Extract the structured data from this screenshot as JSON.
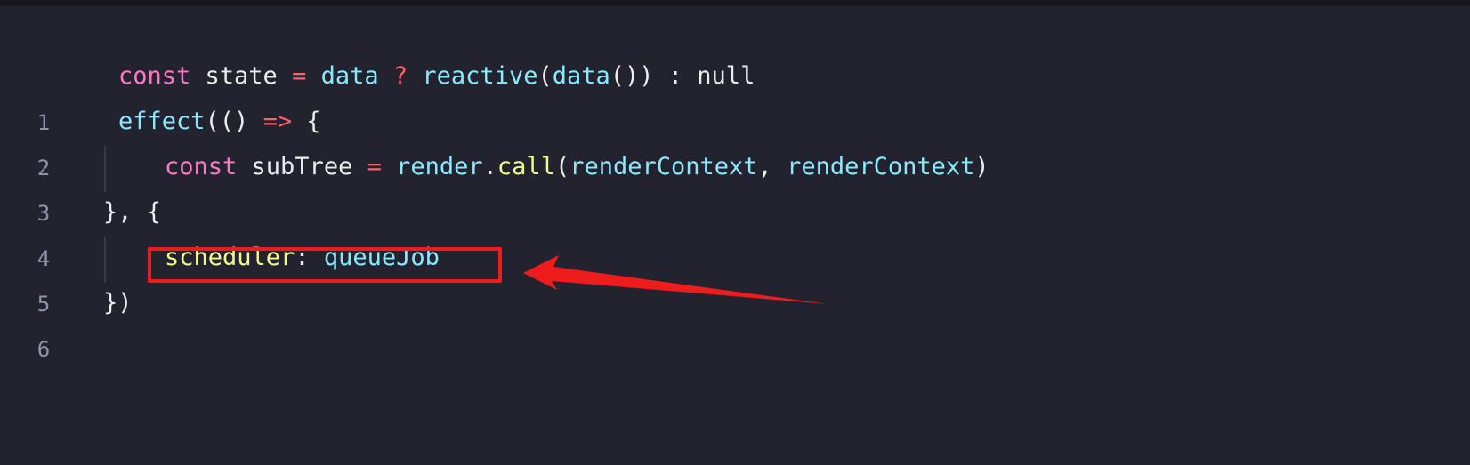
{
  "editor": {
    "lines": [
      {
        "number": "1",
        "tokens": [
          "const",
          " state ",
          "=",
          " data ",
          "?",
          " reactive",
          "(",
          "data",
          "()) : null"
        ]
      },
      {
        "number": "2",
        "tokens": [
          "effect",
          "(() ",
          "=>",
          " {"
        ]
      },
      {
        "number": "3",
        "tokens": [
          "const",
          " subTree ",
          "=",
          " render",
          ".",
          "call",
          "(",
          "renderContext",
          ", ",
          "renderContext",
          ")"
        ]
      },
      {
        "number": "4",
        "tokens": [
          "}, {"
        ]
      },
      {
        "number": "5",
        "tokens": [
          "scheduler",
          ": ",
          "queueJob"
        ]
      },
      {
        "number": "6",
        "tokens": [
          "})"
        ]
      }
    ]
  },
  "annotation": {
    "highlight_color": "#ee1c1c",
    "highlighted_line": "5",
    "arrow_icon": "red-arrow-left"
  },
  "colors": {
    "background": "#23232f",
    "keyword": "#ff79c6",
    "operator": "#ff5f6d",
    "identifier": "#8be9fd",
    "property": "#f1fa8c",
    "text": "#ededed",
    "line_number": "#8f93a8"
  }
}
